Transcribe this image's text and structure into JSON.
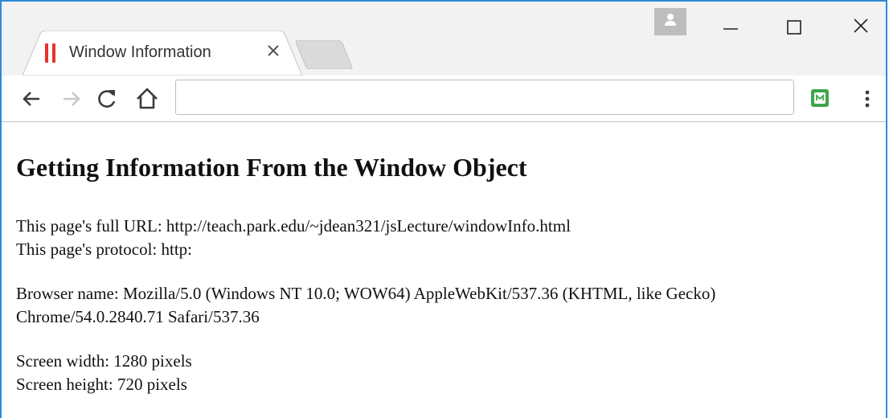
{
  "tab": {
    "title": "Window Information",
    "close_symbol": "×"
  },
  "toolbar": {
    "address_value": ""
  },
  "page": {
    "heading": "Getting Information From the Window Object",
    "url_line": "This page's full URL: http://teach.park.edu/~jdean321/jsLecture/windowInfo.html",
    "protocol_line": "This page's protocol: http:",
    "browser_line_1": "Browser name: Mozilla/5.0 (Windows NT 10.0; WOW64) AppleWebKit/537.36 (KHTML, like Gecko)",
    "browser_line_2": "Chrome/54.0.2840.71 Safari/537.36",
    "width_line": "Screen width: 1280 pixels",
    "height_line": "Screen height: 720 pixels"
  },
  "icons": {
    "favicon": "pause-bars-icon",
    "tab_close": "close-icon",
    "profile": "person-icon",
    "minimize": "minimize-icon",
    "maximize": "maximize-icon",
    "close_window": "close-icon",
    "back": "arrow-left-icon",
    "forward": "arrow-right-icon",
    "reload": "reload-icon",
    "home": "home-icon",
    "extension": "extension-icon",
    "menu": "vertical-dots-icon"
  },
  "colors": {
    "window_border": "#2f8ad6",
    "favicon_red": "#e8332a",
    "extension_green": "#3fa64a"
  }
}
